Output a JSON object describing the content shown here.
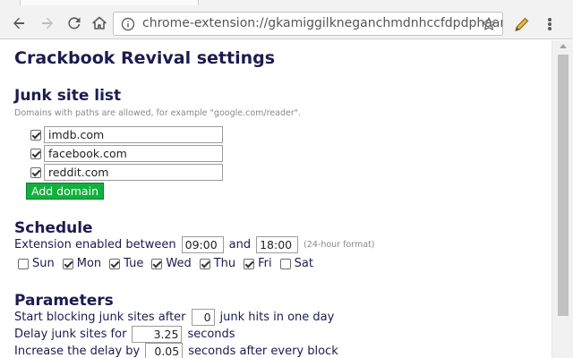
{
  "browser": {
    "url": "chrome-extension://gkamiggilkneganchmdnhccfdpdphaam/c"
  },
  "page": {
    "title": "Crackbook Revival settings"
  },
  "junk_list": {
    "heading": "Junk site list",
    "hint": "Domains with paths are allowed, for example \"google.com/reader\".",
    "domains": [
      {
        "value": "imdb.com",
        "checked": true
      },
      {
        "value": "facebook.com",
        "checked": true
      },
      {
        "value": "reddit.com",
        "checked": true
      }
    ],
    "add_button": "Add domain"
  },
  "schedule": {
    "heading": "Schedule",
    "enabled_between": "Extension enabled between",
    "start_time": "09:00",
    "and": "and",
    "end_time": "18:00",
    "format_note": "(24-hour format)",
    "days": [
      {
        "label": "Sun",
        "checked": false
      },
      {
        "label": "Mon",
        "checked": true
      },
      {
        "label": "Tue",
        "checked": true
      },
      {
        "label": "Wed",
        "checked": true
      },
      {
        "label": "Thu",
        "checked": true
      },
      {
        "label": "Fri",
        "checked": true
      },
      {
        "label": "Sat",
        "checked": false
      }
    ]
  },
  "parameters": {
    "heading": "Parameters",
    "start_blocking_prefix": "Start blocking junk sites after",
    "start_blocking_value": "0",
    "start_blocking_suffix": "junk hits in one day",
    "delay_prefix": "Delay junk sites for",
    "delay_value": "3.25",
    "delay_suffix": "seconds",
    "increase_prefix": "Increase the delay by",
    "increase_value": "0.05",
    "increase_suffix": "seconds after every block"
  }
}
